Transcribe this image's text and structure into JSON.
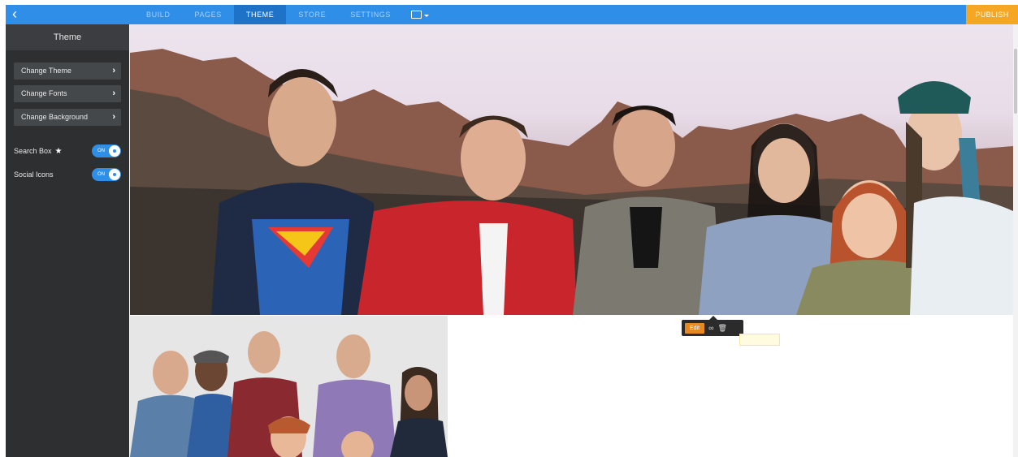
{
  "topbar": {
    "back_icon": "chevron-left-icon",
    "nav": [
      "BUILD",
      "PAGES",
      "THEME",
      "STORE",
      "SETTINGS"
    ],
    "active_nav": "THEME",
    "device_icon": "monitor-icon",
    "publish_label": "PUBLISH",
    "accent": "#2f8fe8",
    "publish_color": "#f5a623"
  },
  "sidebar": {
    "title": "Theme",
    "menu": [
      {
        "label": "Change Theme",
        "icon": "chevron-right-icon"
      },
      {
        "label": "Change Fonts",
        "icon": "chevron-right-icon"
      },
      {
        "label": "Change Background",
        "icon": "chevron-right-icon"
      }
    ],
    "toggles": [
      {
        "label": "Search Box",
        "icon": "star-icon",
        "state": "ON"
      },
      {
        "label": "Social Icons",
        "state": "ON"
      }
    ]
  },
  "editor_toolbar": {
    "edit_label": "Edit",
    "link_icon": "link-icon",
    "delete_icon": "trash-icon",
    "edit_color": "#e8891f"
  }
}
